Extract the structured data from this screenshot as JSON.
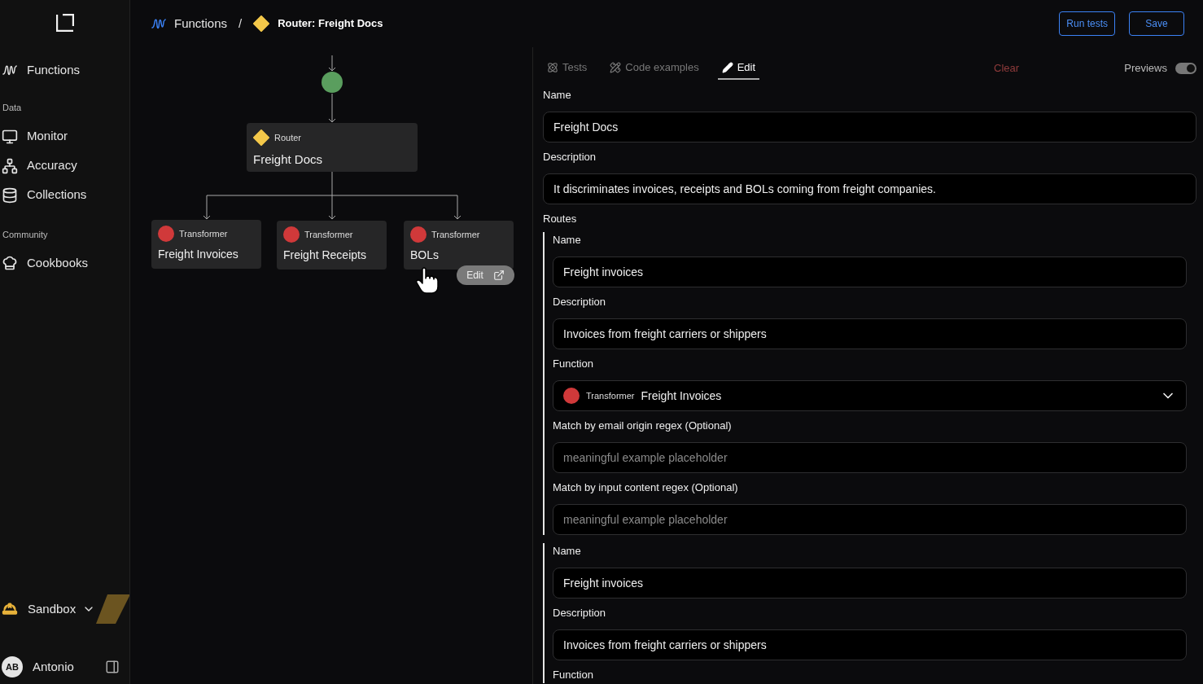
{
  "sidebar": {
    "sections": [
      {
        "items": [
          {
            "kind": "functions",
            "label": "Functions"
          }
        ]
      },
      {
        "title": "Data",
        "items": [
          {
            "kind": "monitor",
            "label": "Monitor"
          },
          {
            "kind": "accuracy",
            "label": "Accuracy"
          },
          {
            "kind": "collections",
            "label": "Collections"
          }
        ]
      },
      {
        "title": "Community",
        "items": [
          {
            "kind": "cookbooks",
            "label": "Cookbooks"
          }
        ]
      }
    ],
    "workspace": {
      "label": "Sandbox"
    },
    "user": {
      "initials": "AB",
      "name": "Antonio"
    }
  },
  "breadcrumb": [
    {
      "kind": "functions",
      "label": "Functions"
    },
    {
      "kind": "router",
      "label": "Router: Freight Docs"
    }
  ],
  "breadcrumb_separator": "/",
  "actions": [
    "Run tests",
    "Save"
  ],
  "diagram": {
    "root": {
      "kind": "router",
      "type_label": "Router",
      "name": "Freight Docs"
    },
    "children": [
      {
        "kind": "transformer",
        "type_label": "Transformer",
        "name": "Freight Invoices",
        "hovered": false
      },
      {
        "kind": "transformer",
        "type_label": "Transformer",
        "name": "Freight Receipts",
        "hovered": false
      },
      {
        "kind": "transformer",
        "type_label": "Transformer",
        "name": "BOLs",
        "hovered": true
      }
    ],
    "hover_action": "Edit"
  },
  "tabs": [
    {
      "kind": "tests",
      "label": "Tests",
      "selected": false
    },
    {
      "kind": "code",
      "label": "Code examples",
      "selected": false
    },
    {
      "kind": "edit",
      "label": "Edit",
      "selected": true
    }
  ],
  "clear": "Clear",
  "previews": {
    "label": "Previews",
    "on": true
  },
  "fields": [
    {
      "label": "Name",
      "value": "Freight Docs"
    },
    {
      "label": "Description",
      "value": "It discriminates invoices, receipts and BOLs coming from freight companies."
    }
  ],
  "routes_label": "Routes",
  "routes": [
    {
      "fields": [
        {
          "kind": "input",
          "label": "Name",
          "value": "Freight invoices"
        },
        {
          "kind": "input",
          "label": "Description",
          "value": "Invoices from freight carriers or shippers"
        },
        {
          "kind": "select",
          "label": "Function",
          "function": {
            "kind": "transformer",
            "type_label": "Transformer",
            "name": "Freight Invoices"
          }
        },
        {
          "kind": "input",
          "label": "Match by email origin regex (Optional)",
          "placeholder": "meaningful example placeholder"
        },
        {
          "kind": "input",
          "label": "Match by input content regex (Optional)",
          "placeholder": "meaningful example placeholder"
        }
      ]
    },
    {
      "fields": [
        {
          "kind": "input",
          "label": "Name",
          "value": "Freight invoices"
        },
        {
          "kind": "input",
          "label": "Description",
          "value": "Invoices from freight carriers or shippers"
        },
        {
          "kind": "label",
          "label": "Function"
        }
      ]
    }
  ]
}
